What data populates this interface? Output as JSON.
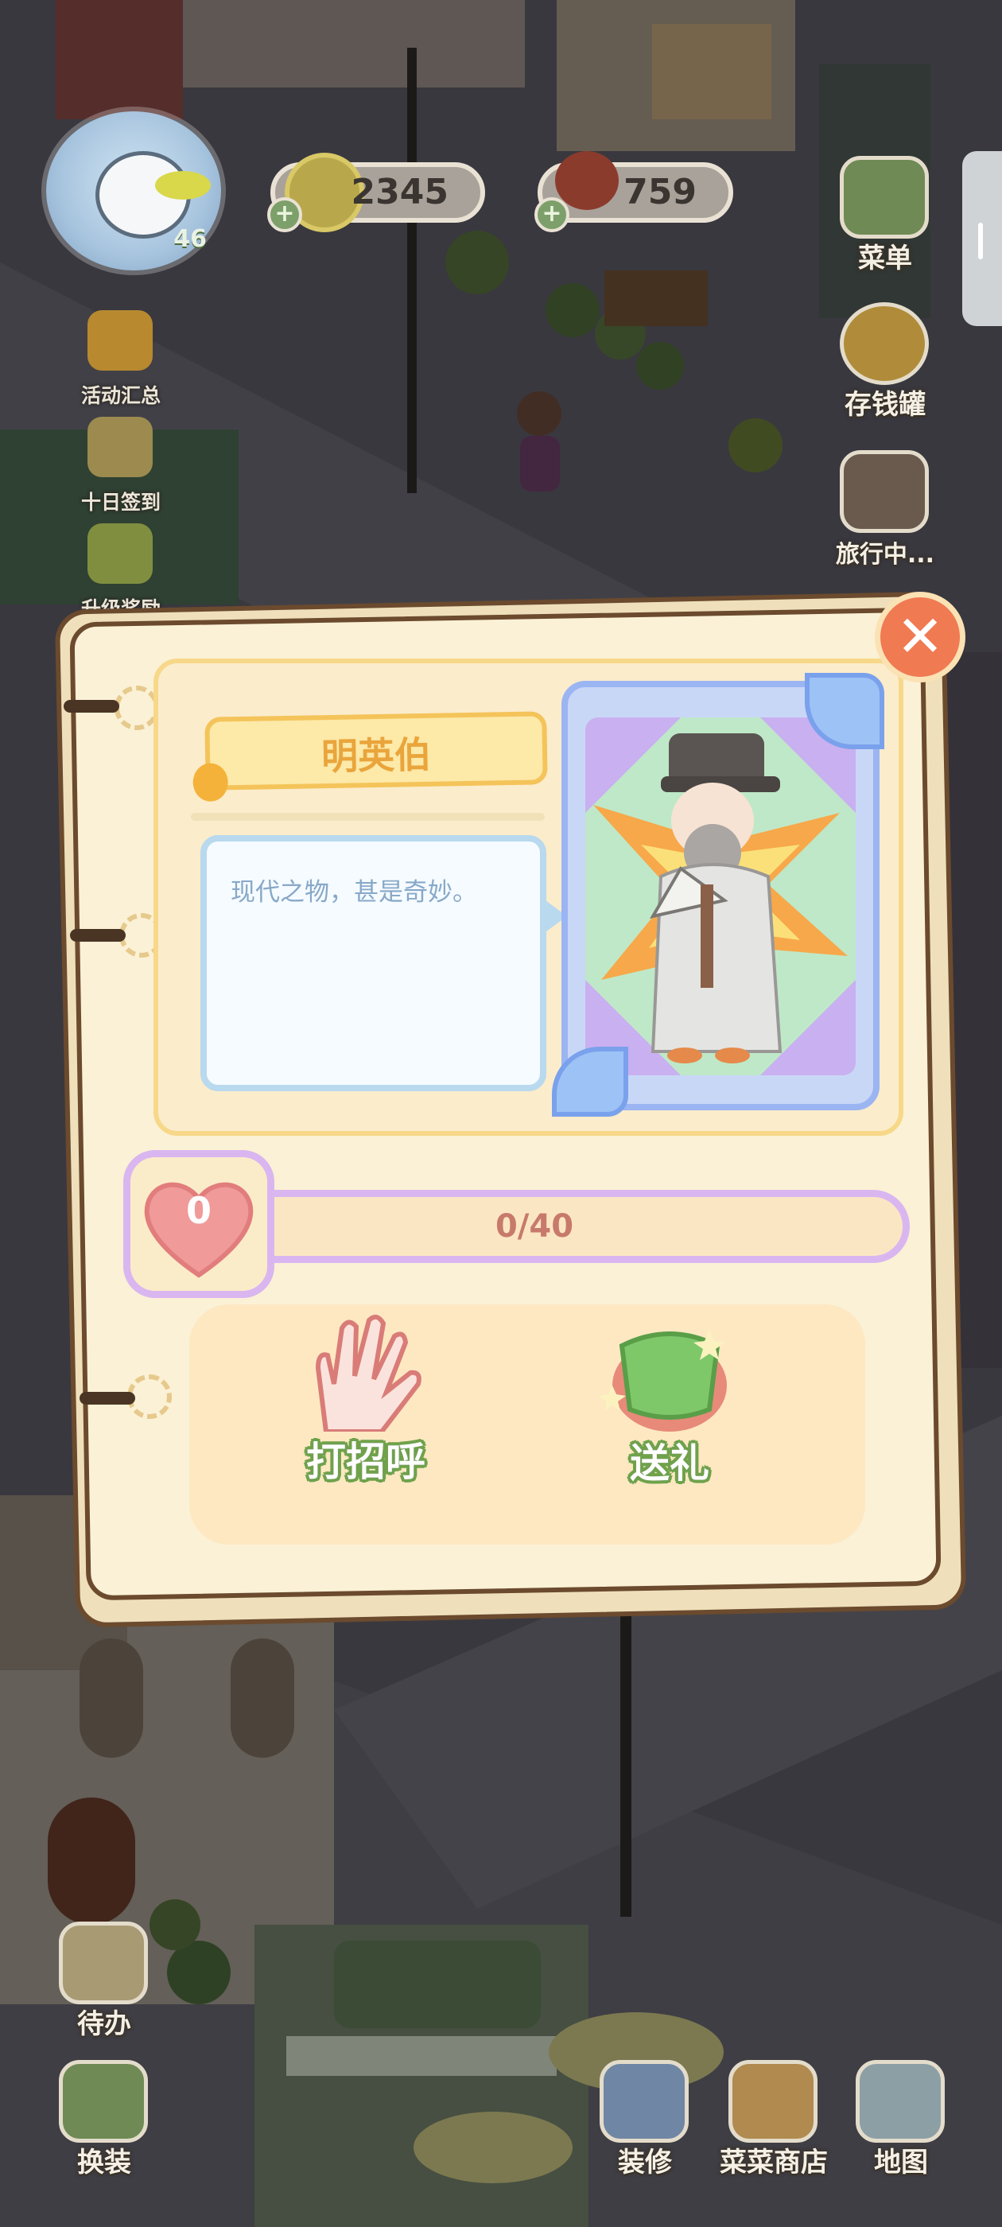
{
  "hud": {
    "level": "46",
    "coins": "2345",
    "tomatoes": "759",
    "plus": "+"
  },
  "left_menu": [
    {
      "label": "活动汇总",
      "icon": "event-summary-icon"
    },
    {
      "label": "十日签到",
      "icon": "checkin-calendar-icon"
    },
    {
      "label": "升级奖励",
      "icon": "level-reward-icon"
    }
  ],
  "right_menu": [
    {
      "label": "菜单",
      "icon": "menu-tv-icon"
    },
    {
      "label": "存钱罐",
      "icon": "piggy-bank-icon"
    },
    {
      "label": "旅行中...",
      "icon": "camera-icon"
    }
  ],
  "dialog": {
    "character_name": "明英伯",
    "speech": "现代之物，甚是奇妙。",
    "favor_level": "0",
    "favor_progress_text": "0/40",
    "favor_progress_fraction": 0,
    "actions": [
      {
        "label": "打招呼",
        "icon": "waving-hand-icon"
      },
      {
        "label": "送礼",
        "icon": "gift-bag-icon"
      }
    ],
    "close_symbol": "✕"
  },
  "bottom_left": [
    {
      "label": "待办",
      "icon": "todo-list-icon"
    },
    {
      "label": "换装",
      "icon": "wardrobe-icon"
    }
  ],
  "bottom_right": [
    {
      "label": "装修",
      "icon": "decorate-icon"
    },
    {
      "label": "菜菜商店",
      "icon": "shop-icon"
    },
    {
      "label": "地图",
      "icon": "map-icon"
    }
  ],
  "colors": {
    "accent_orange": "#f07a52",
    "name_gold": "#e9a53c",
    "progress_pink": "#c77a6c",
    "action_green": "#6fa24b",
    "card_blue": "#9bb5f2"
  }
}
